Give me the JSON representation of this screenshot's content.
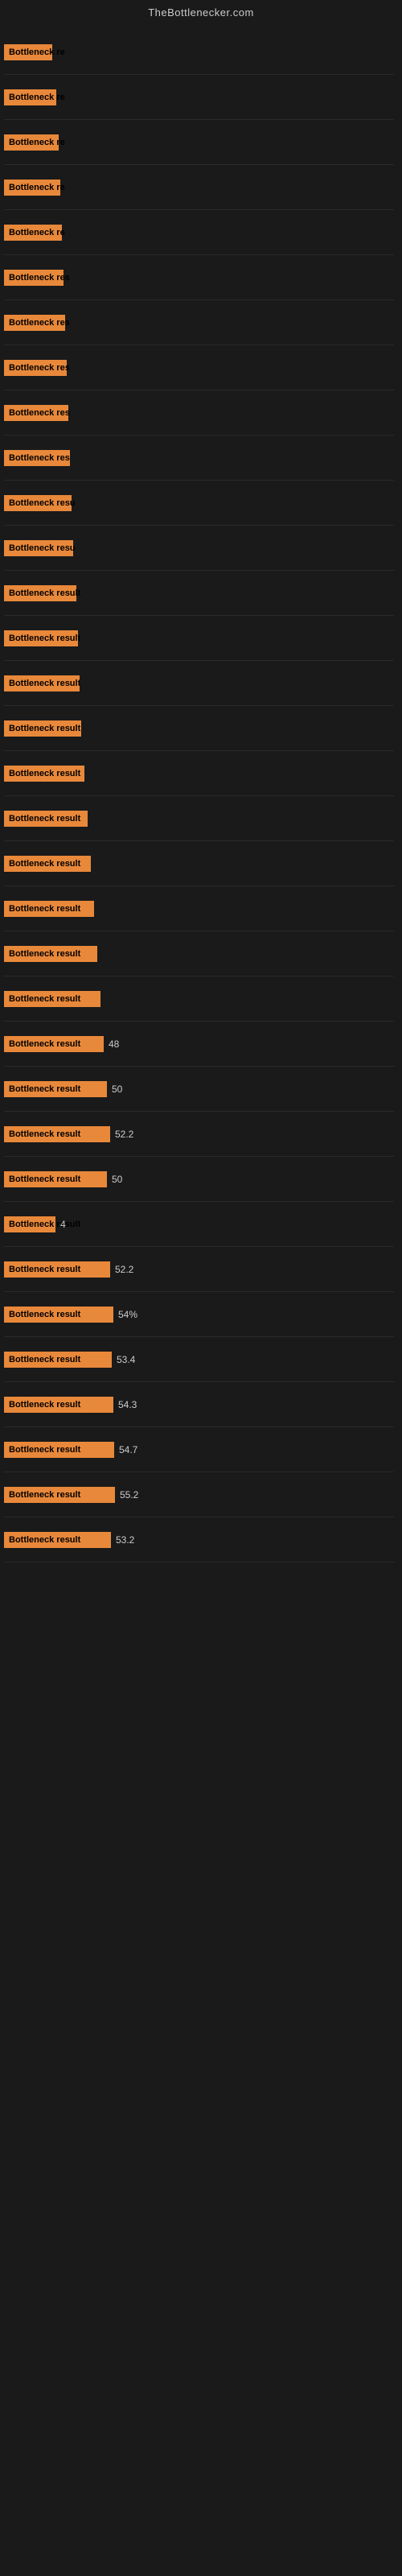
{
  "header": {
    "title": "TheBottlenecker.com"
  },
  "bars": [
    {
      "label": "Bottleneck re",
      "value": "",
      "width": 60
    },
    {
      "label": "Bottleneck re",
      "value": "",
      "width": 65
    },
    {
      "label": "Bottleneck re",
      "value": "",
      "width": 68
    },
    {
      "label": "Bottleneck re",
      "value": "",
      "width": 70
    },
    {
      "label": "Bottleneck re",
      "value": "",
      "width": 72
    },
    {
      "label": "Bottleneck res",
      "value": "",
      "width": 74
    },
    {
      "label": "Bottleneck res",
      "value": "",
      "width": 76
    },
    {
      "label": "Bottleneck res",
      "value": "",
      "width": 78
    },
    {
      "label": "Bottleneck res",
      "value": "",
      "width": 80
    },
    {
      "label": "Bottleneck res",
      "value": "",
      "width": 82
    },
    {
      "label": "Bottleneck resu",
      "value": "",
      "width": 84
    },
    {
      "label": "Bottleneck resu",
      "value": "",
      "width": 86
    },
    {
      "label": "Bottleneck result",
      "value": "",
      "width": 90
    },
    {
      "label": "Bottleneck result",
      "value": "",
      "width": 92
    },
    {
      "label": "Bottleneck result",
      "value": "",
      "width": 94
    },
    {
      "label": "Bottleneck result",
      "value": "",
      "width": 96
    },
    {
      "label": "Bottleneck result",
      "value": "",
      "width": 100
    },
    {
      "label": "Bottleneck result",
      "value": "",
      "width": 104
    },
    {
      "label": "Bottleneck result",
      "value": "",
      "width": 108
    },
    {
      "label": "Bottleneck result",
      "value": "",
      "width": 112
    },
    {
      "label": "Bottleneck result",
      "value": "",
      "width": 116
    },
    {
      "label": "Bottleneck result",
      "value": "",
      "width": 120
    },
    {
      "label": "Bottleneck result",
      "value": "48",
      "width": 124
    },
    {
      "label": "Bottleneck result",
      "value": "50",
      "width": 128
    },
    {
      "label": "Bottleneck result",
      "value": "52.2",
      "width": 132
    },
    {
      "label": "Bottleneck result",
      "value": "50",
      "width": 128
    },
    {
      "label": "Bottleneck result",
      "value": "4",
      "width": 64
    },
    {
      "label": "Bottleneck result",
      "value": "52.2",
      "width": 132
    },
    {
      "label": "Bottleneck result",
      "value": "54%",
      "width": 136
    },
    {
      "label": "Bottleneck result",
      "value": "53.4",
      "width": 134
    },
    {
      "label": "Bottleneck result",
      "value": "54.3",
      "width": 136
    },
    {
      "label": "Bottleneck result",
      "value": "54.7",
      "width": 137
    },
    {
      "label": "Bottleneck result",
      "value": "55.2",
      "width": 138
    },
    {
      "label": "Bottleneck result",
      "value": "53.2",
      "width": 133
    }
  ]
}
